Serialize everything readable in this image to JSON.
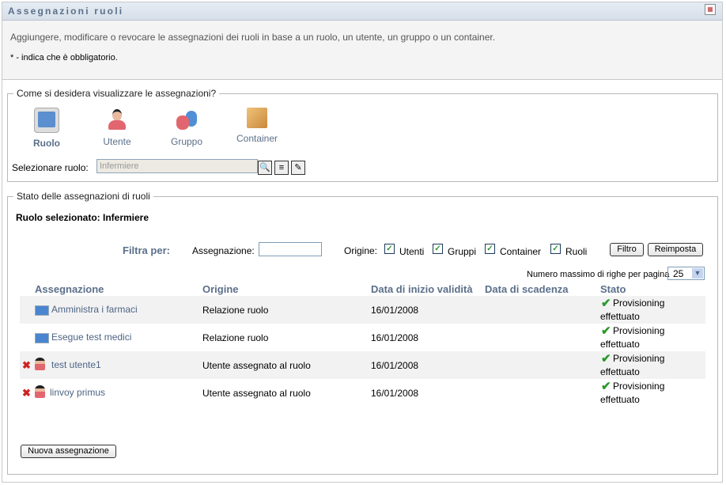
{
  "header": {
    "title": "Assegnazioni ruoli"
  },
  "description": {
    "text": "Aggiungere, modificare o revocare le assegnazioni dei ruoli in base a un ruolo, un utente, un gruppo o un container.",
    "required_note": "* - indica che è obbligatorio."
  },
  "view": {
    "legend": "Come si desidera visualizzare le assegnazioni?",
    "options": [
      {
        "label": "Ruolo",
        "selected": true
      },
      {
        "label": "Utente"
      },
      {
        "label": "Gruppo"
      },
      {
        "label": "Container"
      }
    ],
    "select_label": "Selezionare ruolo:",
    "select_value": "Infermiere"
  },
  "status": {
    "legend": "Stato delle assegnazioni di ruoli",
    "selected_role": "Ruolo selezionato: Infermiere",
    "filter": {
      "label": "Filtra per:",
      "assignment_label": "Assegnazione:",
      "assignment_value": "",
      "origin_label": "Origine:",
      "origins": [
        {
          "label": "Utenti",
          "checked": true
        },
        {
          "label": "Gruppi",
          "checked": true
        },
        {
          "label": "Container",
          "checked": true
        },
        {
          "label": "Ruoli",
          "checked": true
        }
      ],
      "filter_button": "Filtro",
      "reset_button": "Reimposta"
    },
    "rows_per_page_label": "Numero massimo di righe per pagina",
    "rows_per_page": "25",
    "columns": [
      "Assegnazione",
      "Origine",
      "Data di inizio validità",
      "Data di scadenza",
      "Stato"
    ],
    "rows": [
      {
        "assignment": "Amministra i farmaci",
        "origin": "Relazione ruolo",
        "start": "16/01/2008",
        "end": "",
        "status1": "Provisioning",
        "status2": "effettuato",
        "type": "role"
      },
      {
        "assignment": "Esegue test medici",
        "origin": "Relazione ruolo",
        "start": "16/01/2008",
        "end": "",
        "status1": "Provisioning",
        "status2": "effettuato",
        "type": "role"
      },
      {
        "assignment": "test utente1",
        "origin": "Utente assegnato al ruolo",
        "start": "16/01/2008",
        "end": "",
        "status1": "Provisioning",
        "status2": "effettuato",
        "type": "user"
      },
      {
        "assignment": "linvoy primus",
        "origin": "Utente assegnato al ruolo",
        "start": "16/01/2008",
        "end": "",
        "status1": "Provisioning",
        "status2": "effettuato",
        "type": "user"
      }
    ],
    "new_button": "Nuova assegnazione"
  },
  "colors": {
    "accent": "#5b6f8a",
    "header_bg": "#dfe6ee"
  }
}
